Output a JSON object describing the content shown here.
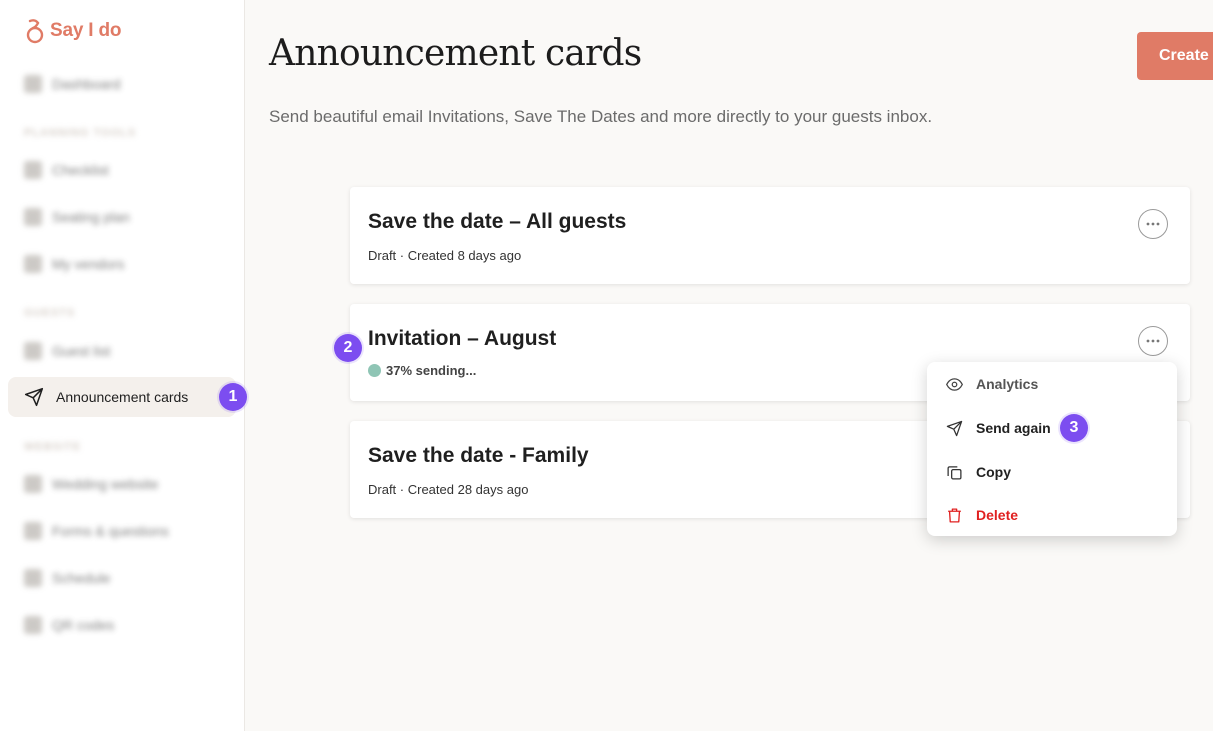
{
  "app": {
    "logo_text": "Say I do",
    "brand_color": "#e07b66"
  },
  "sidebar": {
    "items": [
      {
        "label": "Dashboard",
        "icon": "dashboard-icon"
      },
      {
        "section": "PLANNING TOOLS"
      },
      {
        "label": "Checklist",
        "icon": "checklist-icon"
      },
      {
        "label": "Seating plan",
        "icon": "seating-icon"
      },
      {
        "label": "My vendors",
        "icon": "vendors-icon"
      },
      {
        "section": "GUESTS"
      },
      {
        "label": "Guest list",
        "icon": "guest-list-icon"
      },
      {
        "label": "Announcement cards",
        "icon": "paper-plane-icon",
        "active": true
      },
      {
        "section": "WEBSITE"
      },
      {
        "label": "Wedding website",
        "icon": "globe-icon"
      },
      {
        "label": "Forms & questions",
        "icon": "form-icon"
      },
      {
        "label": "Schedule",
        "icon": "calendar-icon"
      },
      {
        "label": "QR codes",
        "icon": "qr-icon"
      }
    ]
  },
  "main": {
    "title": "Announcement cards",
    "subtitle": "Send beautiful email Invitations, Save The Dates and more directly to your guests inbox.",
    "create_label": "Create",
    "cards": [
      {
        "title": "Save the date – All guests",
        "meta": "Draft · Created 8 days ago"
      },
      {
        "title": "Invitation – August",
        "status": "37% sending...",
        "status_color": "#8fc5b5"
      },
      {
        "title": "Save the date - Family",
        "meta": "Draft · Created 28 days ago"
      }
    ]
  },
  "menu": {
    "items": [
      {
        "label": "Analytics",
        "icon": "eye-icon"
      },
      {
        "label": "Send again",
        "icon": "paper-plane-icon"
      },
      {
        "label": "Copy",
        "icon": "copy-icon"
      },
      {
        "label": "Delete",
        "icon": "trash-icon",
        "color": "#e02020"
      }
    ]
  },
  "steps": [
    "1",
    "2",
    "3"
  ],
  "colors": {
    "step_badge": "#7c4df0",
    "delete": "#e02020"
  }
}
